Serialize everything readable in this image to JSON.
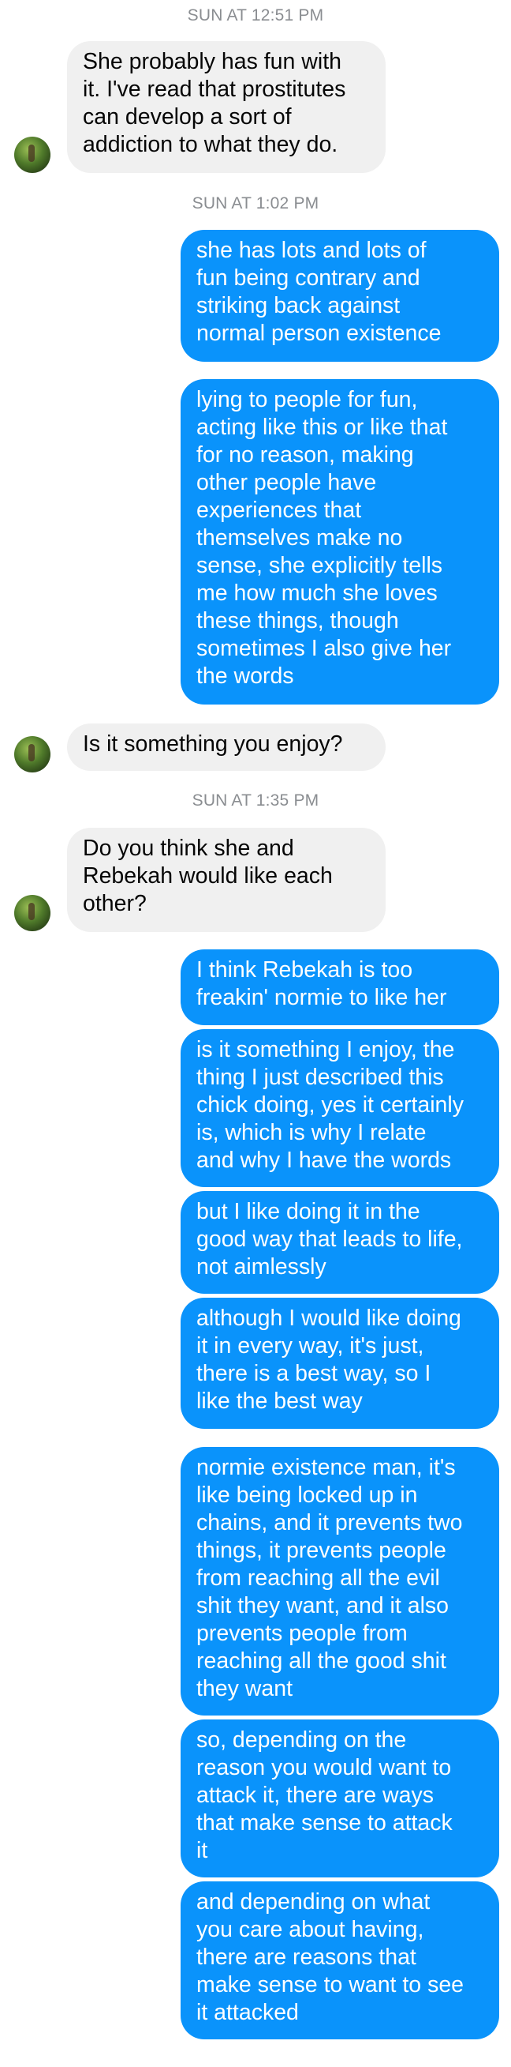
{
  "timestamps": [
    "SUN AT 12:51 PM",
    "SUN AT 1:02 PM",
    "SUN AT 1:35 PM"
  ],
  "messages": [
    {
      "from": "them",
      "text": "She probably has fun with\nit. I've read that prostitutes\ncan develop a sort of\naddiction to what they do."
    },
    {
      "from": "me",
      "text": "she has lots and lots of\nfun being contrary and\nstriking back against\nnormal person existence"
    },
    {
      "from": "me",
      "text": "lying to people for fun,\nacting like this or like that\nfor no reason, making\nother people have\nexperiences that\nthemselves make no\nsense, she explicitly tells\nme how much she loves\nthese things, though\nsometimes I also give her\nthe words"
    },
    {
      "from": "them",
      "text": "Is it something you enjoy?"
    },
    {
      "from": "them",
      "text": "Do you think she and\nRebekah would like each\nother?"
    },
    {
      "from": "me",
      "text": "I think Rebekah is too\nfreakin' normie to like her"
    },
    {
      "from": "me",
      "text": "is it something I enjoy, the\nthing I just described this\nchick doing, yes it certainly\nis, which is why I relate\nand why I have the words"
    },
    {
      "from": "me",
      "text": "but I like doing it in the\ngood way that leads to life,\nnot aimlessly"
    },
    {
      "from": "me",
      "text": "although I would like doing\nit in every way, it's just,\nthere is a best way, so I\nlike the best way"
    },
    {
      "from": "me",
      "text": "normie existence man, it's\nlike being locked up in\nchains, and it prevents two\nthings, it prevents people\nfrom reaching all the evil\nshit they want, and it also\nprevents people from\nreaching all the good shit\nthey want"
    },
    {
      "from": "me",
      "text": "so, depending on the\nreason you would want to\nattack it, there are ways\nthat make sense to attack\nit"
    },
    {
      "from": "me",
      "text": "and depending on what\nyou care about having,\nthere are reasons that\nmake sense to want to see\nit attacked"
    }
  ],
  "colors": {
    "outgoing": "#0a93fb",
    "incoming": "#f0f0f0",
    "timestamp": "#8a8d91"
  },
  "icons": {
    "avatar": "contact-avatar"
  }
}
